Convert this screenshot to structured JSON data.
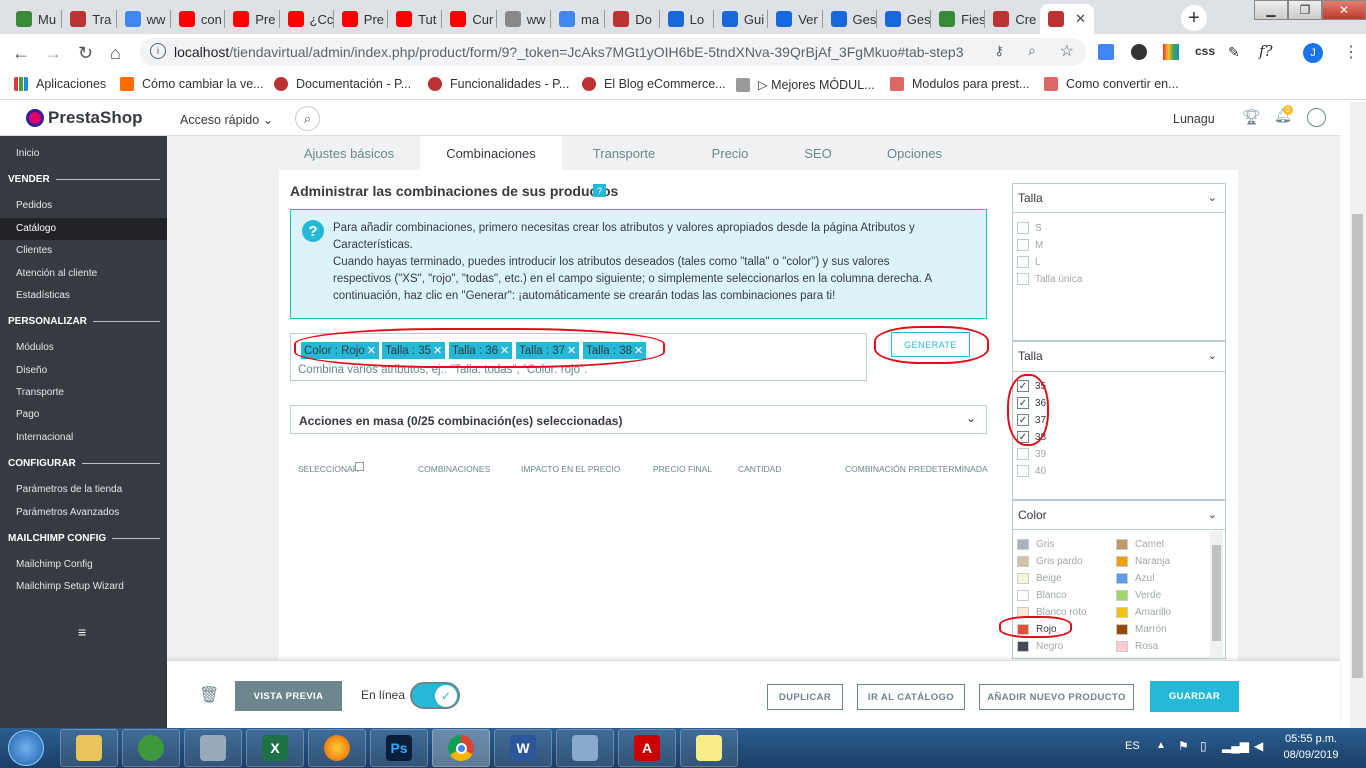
{
  "browser": {
    "tabs": [
      {
        "label": "Mu",
        "icon": "palm-icon",
        "color": "#3a8a3a"
      },
      {
        "label": "Tra",
        "icon": "prestashop-icon",
        "color": "#b33"
      },
      {
        "label": "ww",
        "icon": "google-icon",
        "color": "#4285f4"
      },
      {
        "label": "con",
        "icon": "youtube-icon",
        "color": "#f00"
      },
      {
        "label": "Pre",
        "icon": "youtube-icon",
        "color": "#f00"
      },
      {
        "label": "¿Cc",
        "icon": "youtube-icon",
        "color": "#f00"
      },
      {
        "label": "Pre",
        "icon": "youtube-icon",
        "color": "#f00"
      },
      {
        "label": "Tut",
        "icon": "youtube-icon",
        "color": "#f00"
      },
      {
        "label": "Cur",
        "icon": "youtube-icon",
        "color": "#f00"
      },
      {
        "label": "ww",
        "icon": "video-icon",
        "color": "#888"
      },
      {
        "label": "ma",
        "icon": "google-icon",
        "color": "#4285f4"
      },
      {
        "label": "Do",
        "icon": "prestashop-icon",
        "color": "#b33"
      },
      {
        "label": "Lo",
        "icon": "confluence-icon",
        "color": "#1868db"
      },
      {
        "label": "Gui",
        "icon": "confluence-icon",
        "color": "#1868db"
      },
      {
        "label": "Ver",
        "icon": "confluence-icon",
        "color": "#1868db"
      },
      {
        "label": "Ges",
        "icon": "confluence-icon",
        "color": "#1868db"
      },
      {
        "label": "Ges",
        "icon": "confluence-icon",
        "color": "#1868db"
      },
      {
        "label": "Fies",
        "icon": "palm-icon",
        "color": "#3a8a3a"
      },
      {
        "label": "Cre",
        "icon": "prestashop-icon",
        "color": "#b33"
      },
      {
        "label": "",
        "icon": "prestashop-icon",
        "color": "#b33"
      }
    ],
    "new_tab": "+",
    "url_host": "localhost",
    "url_path": "/tiendavirtual/admin/index.php/product/form/9?_token=JcAks7MGt1yOIH6bE-5tndXNva-39QrBjAf_3FgMkuo#tab-step3",
    "ext_css": "css",
    "ext_f": "f?",
    "profile": "J",
    "bookmarks": [
      "Aplicaciones",
      "Cómo cambiar la ve...",
      "Documentación - P...",
      "Funcionalidades - P...",
      "El Blog eCommerce...",
      "▷ Mejores MÓDUL...",
      "Modulos para prest...",
      "Como convertir en..."
    ]
  },
  "header": {
    "logo": "PrestaShop",
    "quick_access": "Acceso rápido",
    "user": "Lunagu",
    "notif_count": "0"
  },
  "sidebar": {
    "home": "Inicio",
    "sec_vender": "VENDER",
    "pedidos": "Pedidos",
    "catalogo": "Catálogo",
    "clientes": "Clientes",
    "atencion": "Atención al cliente",
    "estadisticas": "Estadísticas",
    "sec_personalizar": "PERSONALIZAR",
    "modulos": "Módulos",
    "diseno": "Diseño",
    "transporte": "Transporte",
    "pago": "Pago",
    "internacional": "Internacional",
    "sec_configurar": "CONFIGURAR",
    "parametros_tienda": "Parámetros de la tienda",
    "parametros_avanzados": "Parámetros Avanzados",
    "sec_mailchimp": "MAILCHIMP CONFIG",
    "mailchimp_config": "Mailchimp Config",
    "mailchimp_wizard": "Mailchimp Setup Wizard"
  },
  "product_tabs": [
    "Ajustes básicos",
    "Combinaciones",
    "Transporte",
    "Precio",
    "SEO",
    "Opciones"
  ],
  "combinations": {
    "title": "Administrar las combinaciones de sus productos",
    "help_q": "?",
    "info_lines": [
      "Para añadir combinaciones, primero necesitas crear los atributos y valores apropiados desde la página Atributos y",
      "Características.",
      "Cuando hayas terminado, puedes introducir los atributos deseados (tales como \"talla\" o \"color\") y sus valores",
      "respectivos (\"XS\", \"rojo\", \"todas\", etc.) en el campo siguiente; o simplemente seleccionarlos en la columna derecha. A",
      "continuación, haz clic en \"Generar\": ¡automáticamente se crearán todas las combinaciones para ti!"
    ],
    "tags": [
      "Color : Rojo",
      "Talla : 35",
      "Talla : 36",
      "Talla : 37",
      "Talla : 38"
    ],
    "tag_placeholder": "Combina varios atributos, ej.: \"Talla: todas\", \"Color: rojo\".",
    "generate": "GENERATE",
    "bulk_actions": "Acciones en masa (0/25 combinación(es) seleccionadas)",
    "columns": [
      "SELECCIONAR",
      "COMBINACIONES",
      "IMPACTO EN EL PRECIO",
      "PRECIO FINAL",
      "CANTIDAD",
      "COMBINACIÓN PREDETERMINADA"
    ]
  },
  "filters": {
    "talla1": {
      "title": "Talla",
      "options": [
        "S",
        "M",
        "L",
        "Talla única"
      ]
    },
    "talla2": {
      "title": "Talla",
      "options": [
        {
          "label": "35",
          "checked": true
        },
        {
          "label": "36",
          "checked": true
        },
        {
          "label": "37",
          "checked": true
        },
        {
          "label": "38",
          "checked": true
        },
        {
          "label": "39",
          "checked": false
        },
        {
          "label": "40",
          "checked": false
        }
      ]
    },
    "color": {
      "title": "Color",
      "options": [
        {
          "label": "Gris",
          "color": "#aab2bd"
        },
        {
          "label": "Camel",
          "color": "#c19a6b"
        },
        {
          "label": "Gris pardo",
          "color": "#cfc4a6"
        },
        {
          "label": "Naranja",
          "color": "#f39d13"
        },
        {
          "label": "Beige",
          "color": "#f5f5dc"
        },
        {
          "label": "Azul",
          "color": "#5d9cec"
        },
        {
          "label": "Blanco",
          "color": "#ffffff"
        },
        {
          "label": "Verde",
          "color": "#a0d468"
        },
        {
          "label": "Blanco roto",
          "color": "#faebd7"
        },
        {
          "label": "Amarillo",
          "color": "#f1c40f"
        },
        {
          "label": "Rojo",
          "color": "#e84c3d"
        },
        {
          "label": "Marrón",
          "color": "#964b00"
        },
        {
          "label": "Negro",
          "color": "#434a54"
        },
        {
          "label": "Rosa",
          "color": "#fcccd3"
        }
      ]
    }
  },
  "footer": {
    "preview": "VISTA PREVIA",
    "online": "En línea",
    "duplicate": "DUPLICAR",
    "catalog": "IR AL CATÁLOGO",
    "add_new": "AÑADIR NUEVO PRODUCTO",
    "save": "GUARDAR"
  },
  "taskbar": {
    "lang": "ES",
    "time": "05:55 p.m.",
    "date": "08/09/2019"
  }
}
